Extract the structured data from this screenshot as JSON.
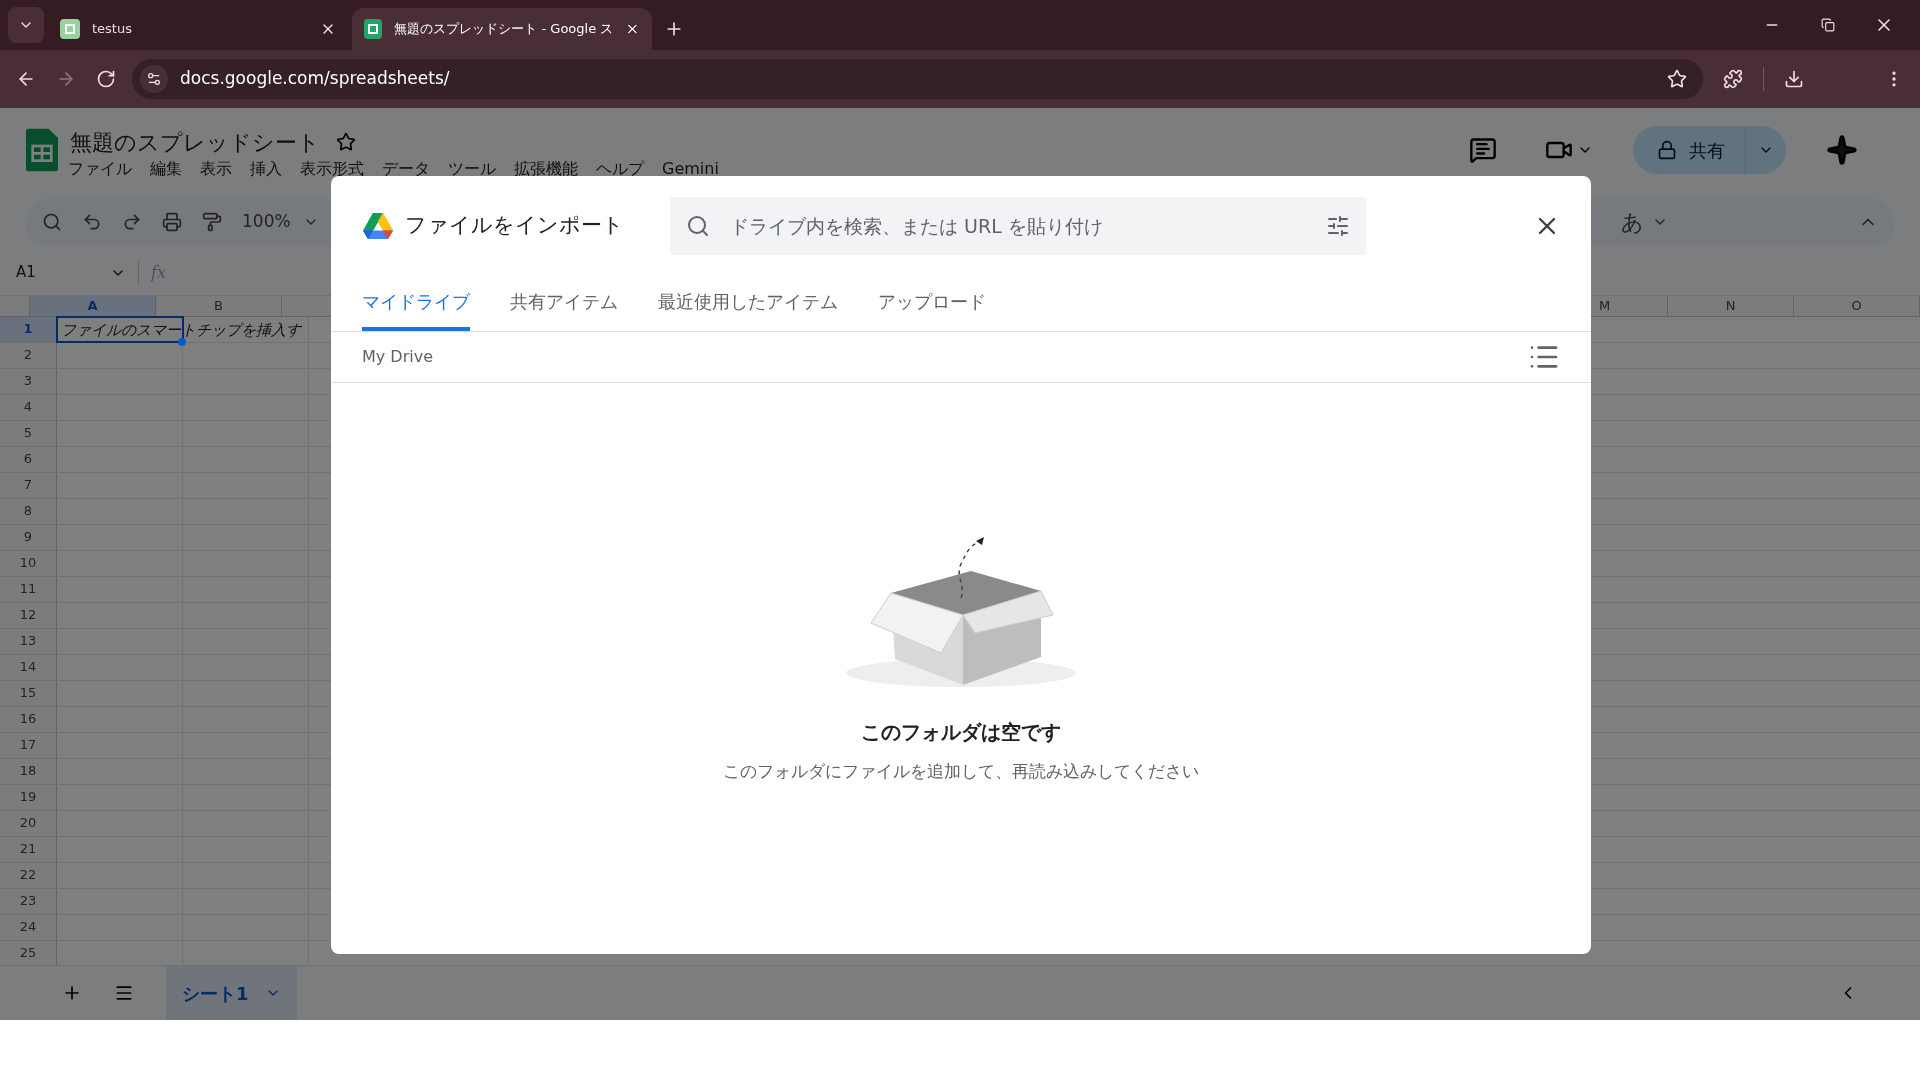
{
  "browser": {
    "tabs": [
      {
        "title": "testus",
        "selected": false
      },
      {
        "title": "無題のスプレッドシート - Google ス",
        "selected": true
      }
    ],
    "url": "docs.google.com/spreadsheets/"
  },
  "sheets": {
    "title": "無題のスプレッドシート",
    "menu": [
      "ファイル",
      "編集",
      "表示",
      "挿入",
      "表示形式",
      "データ",
      "ツール",
      "拡張機能",
      "ヘルプ",
      "Gemini"
    ],
    "zoom": "100%",
    "input_mode": "あ",
    "share": "共有",
    "name_box": "A1",
    "formula_label": "fx",
    "columns": [
      {
        "label": "A",
        "selected": true
      },
      {
        "label": "B",
        "selected": false
      },
      {
        "label": "M",
        "selected": false
      },
      {
        "label": "N",
        "selected": false
      },
      {
        "label": "O",
        "selected": false
      }
    ],
    "rows": [
      {
        "label": "1",
        "selected": true
      },
      {
        "label": "2",
        "selected": false
      },
      {
        "label": "3",
        "selected": false
      },
      {
        "label": "4",
        "selected": false
      },
      {
        "label": "5",
        "selected": false
      },
      {
        "label": "6",
        "selected": false
      },
      {
        "label": "7",
        "selected": false
      },
      {
        "label": "8",
        "selected": false
      },
      {
        "label": "9",
        "selected": false
      },
      {
        "label": "10",
        "selected": false
      },
      {
        "label": "11",
        "selected": false
      },
      {
        "label": "12",
        "selected": false
      },
      {
        "label": "13",
        "selected": false
      },
      {
        "label": "14",
        "selected": false
      },
      {
        "label": "15",
        "selected": false
      },
      {
        "label": "16",
        "selected": false
      },
      {
        "label": "17",
        "selected": false
      },
      {
        "label": "18",
        "selected": false
      },
      {
        "label": "19",
        "selected": false
      },
      {
        "label": "20",
        "selected": false
      },
      {
        "label": "21",
        "selected": false
      },
      {
        "label": "22",
        "selected": false
      },
      {
        "label": "23",
        "selected": false
      },
      {
        "label": "24",
        "selected": false
      },
      {
        "label": "25",
        "selected": false
      }
    ],
    "cell_a1": "ファイルのスマートチップを挿入す",
    "sheet_tabs": [
      {
        "label": "シート1",
        "selected": true
      }
    ]
  },
  "dialog": {
    "title": "ファイルをインポート",
    "search": {
      "placeholder": "ドライブ内を検索、または URL を貼り付け"
    },
    "tabs": [
      {
        "label": "マイドライブ",
        "selected": true
      },
      {
        "label": "共有アイテム",
        "selected": false
      },
      {
        "label": "最近使用したアイテム",
        "selected": false
      },
      {
        "label": "アップロード",
        "selected": false
      }
    ],
    "breadcrumb": "My Drive",
    "empty": {
      "title": "このフォルダは空です",
      "message": "このフォルダにファイルを追加して、再読み込みしてください"
    }
  }
}
